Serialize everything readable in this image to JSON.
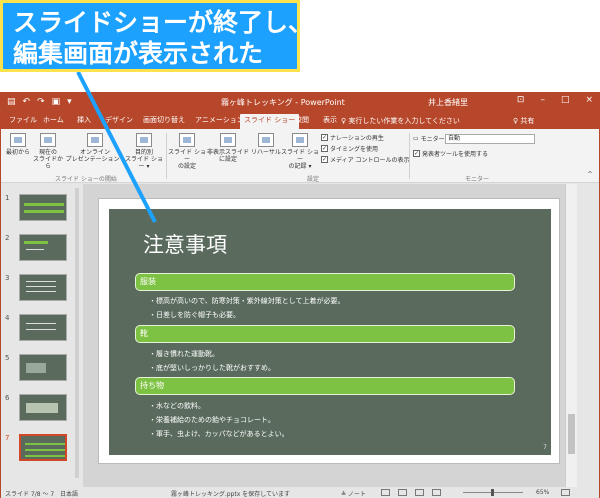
{
  "callout": {
    "line1": "スライドショーが終了し、",
    "line2": "編集画面が表示された"
  },
  "window": {
    "title": "霧ヶ峰トレッキング - PowerPoint",
    "user": "井上香緒里",
    "qat_icons": [
      "save-icon",
      "undo-icon",
      "redo-icon",
      "start-from-beginning-icon"
    ],
    "controls": [
      "⊡",
      "–",
      "□",
      "×"
    ]
  },
  "tabs": [
    {
      "label": "ファイル"
    },
    {
      "label": "ホーム"
    },
    {
      "label": "挿入"
    },
    {
      "label": "デザイン"
    },
    {
      "label": "画面切り替え"
    },
    {
      "label": "アニメーション"
    },
    {
      "label": "スライド ショー"
    },
    {
      "label": "校閲"
    },
    {
      "label": "表示"
    }
  ],
  "tell_me": "♀ 実行したい作業を入力してください",
  "share": "♀ 共有",
  "ribbon": {
    "from_beginning": "最初から",
    "from_current_1": "現在の",
    "from_current_2": "スライドから",
    "online_1": "オンライン",
    "online_2": "プレゼンテーション ▾",
    "custom_1": "目的別",
    "custom_2": "スライド ショー ▾",
    "group_start": "スライド ショーの開始",
    "setup_1": "スライド ショー",
    "setup_2": "の設定",
    "hide_1": "非表示スライド",
    "hide_2": "に設定",
    "rehearse": "リハーサル",
    "record_1": "スライド ショー",
    "record_2": "の記録 ▾",
    "chk_narration": "ナレーションの再生",
    "chk_timing": "タイミングを使用",
    "chk_media": "メディア コントロールの表示",
    "group_setup": "設定",
    "monitor_label": "モニター:",
    "monitor_value": "自動",
    "presenter_view": "発表者ツールを使用する",
    "group_monitor": "モニター"
  },
  "thumbnails": [
    {
      "num": "1"
    },
    {
      "num": "2"
    },
    {
      "num": "3"
    },
    {
      "num": "4"
    },
    {
      "num": "5"
    },
    {
      "num": "6"
    },
    {
      "num": "7"
    }
  ],
  "slide": {
    "title": "注意事項",
    "sections": [
      {
        "heading": "服装",
        "bullets": [
          "・標高が高いので、防寒対策・紫外線対策として上着が必要。",
          "・日差しを防ぐ帽子も必要。"
        ]
      },
      {
        "heading": "靴",
        "bullets": [
          "・履き慣れた運動靴。",
          "・底が堅いしっかりした靴がおすすめ。"
        ]
      },
      {
        "heading": "持ち物",
        "bullets": [
          "・水などの飲料。",
          "・栄養補給のための飴やチョコレート。",
          "・軍手、虫よけ、カッパなどがあるとよい。"
        ]
      }
    ],
    "page": "7"
  },
  "status": {
    "slide_info": "スライド 7/8 ～ 7",
    "language": "日本語",
    "saving": "霧ヶ峰トレッキング.pptx を保存しています",
    "notes": "≜ ノート",
    "zoom": "65%"
  },
  "colors": {
    "accent": "#b7472a",
    "callout_bg": "#1da1ff",
    "callout_border": "#ffe34d",
    "slide_bg": "#5a6b5e",
    "heading_green": "#7dc242"
  }
}
